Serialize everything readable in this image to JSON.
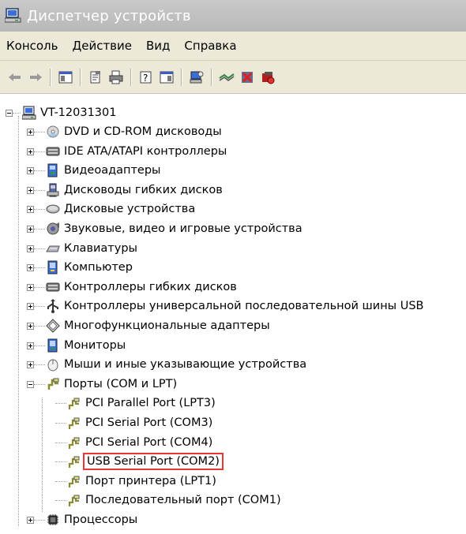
{
  "window": {
    "title": "Диспетчер устройств"
  },
  "menu": [
    "Консоль",
    "Действие",
    "Вид",
    "Справка"
  ],
  "toolbar": {
    "buttons": [
      {
        "name": "back-arrow-icon",
        "glyph": "⇦"
      },
      {
        "name": "forward-arrow-icon",
        "glyph": "⇨"
      },
      {
        "name": "show-hide-tree-icon",
        "glyph": "▣"
      },
      {
        "name": "properties-icon",
        "glyph": "📄"
      },
      {
        "name": "print-icon",
        "glyph": "🖶"
      },
      {
        "name": "help-icon",
        "glyph": "?"
      },
      {
        "name": "view-icon",
        "glyph": "▥"
      },
      {
        "name": "scan-hardware-icon",
        "glyph": "🖥"
      },
      {
        "name": "update-driver-icon",
        "glyph": "≈"
      },
      {
        "name": "uninstall-icon",
        "glyph": "✖"
      },
      {
        "name": "disable-icon",
        "glyph": "■"
      }
    ]
  },
  "tree": {
    "root": "VT-12031301",
    "categories": [
      {
        "label": "DVD и CD-ROM дисководы",
        "icon": "cdrom-icon"
      },
      {
        "label": "IDE ATA/ATAPI контроллеры",
        "icon": "ide-controller-icon"
      },
      {
        "label": "Видеоадаптеры",
        "icon": "display-adapter-icon"
      },
      {
        "label": "Дисководы гибких дисков",
        "icon": "floppy-drive-icon"
      },
      {
        "label": "Дисковые устройства",
        "icon": "disk-drive-icon"
      },
      {
        "label": "Звуковые, видео и игровые устройства",
        "icon": "sound-icon"
      },
      {
        "label": "Клавиатуры",
        "icon": "keyboard-icon"
      },
      {
        "label": "Компьютер",
        "icon": "computer-icon"
      },
      {
        "label": "Контроллеры гибких дисков",
        "icon": "floppy-controller-icon"
      },
      {
        "label": "Контроллеры универсальной последовательной шины USB",
        "icon": "usb-icon"
      },
      {
        "label": "Многофункциональные адаптеры",
        "icon": "multifunction-icon"
      },
      {
        "label": "Мониторы",
        "icon": "monitor-icon"
      },
      {
        "label": "Мыши и иные указывающие устройства",
        "icon": "mouse-icon"
      },
      {
        "label": "Порты (COM и LPT)",
        "icon": "port-icon"
      }
    ],
    "ports": [
      "PCI Parallel Port (LPT3)",
      "PCI Serial Port (COM3)",
      "PCI Serial Port (COM4)",
      "USB Serial Port (COM2)",
      "Порт принтера (LPT1)",
      "Последовательный порт (COM1)"
    ],
    "last": {
      "label": "Процессоры",
      "icon": "processor-icon"
    }
  }
}
